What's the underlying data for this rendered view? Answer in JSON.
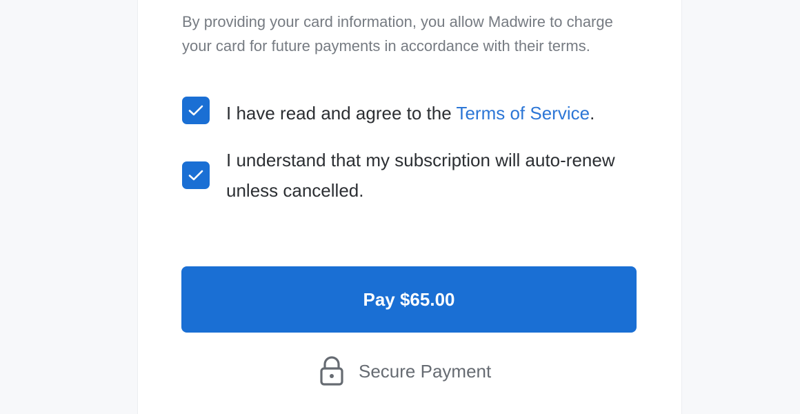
{
  "consent": {
    "text": "By providing your card information, you allow Madwire to charge your card for future payments in accordance with their terms."
  },
  "checkboxes": {
    "terms": {
      "checked": true,
      "label_prefix": "I have read and agree to the ",
      "link_text": "Terms of Service",
      "label_suffix": "."
    },
    "auto_renew": {
      "checked": true,
      "label": "I understand that my subscription will auto-renew unless cancelled."
    }
  },
  "pay_button": {
    "label": "Pay $65.00"
  },
  "secure": {
    "icon": "lock-icon",
    "label": "Secure Payment"
  },
  "colors": {
    "accent": "#1a6fd4",
    "link": "#2c76d6",
    "background": "#f7f8fa"
  }
}
